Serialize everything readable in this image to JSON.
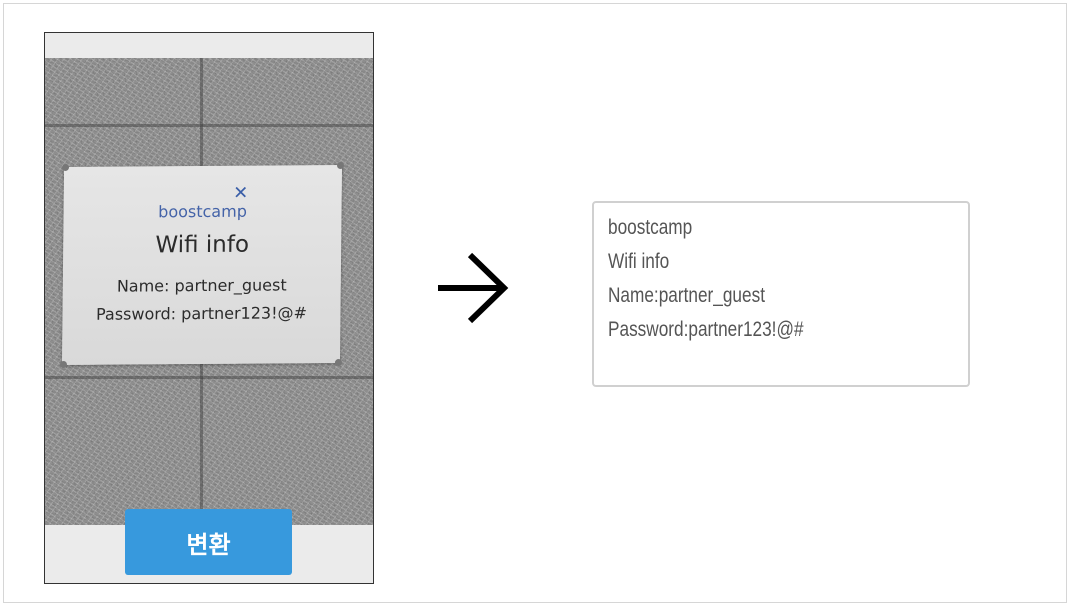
{
  "photo": {
    "sign": {
      "logo_mark": "✕",
      "logo_text": "boostcamp",
      "title": "Wifi info",
      "name_line": "Name: partner_guest",
      "password_line": "Password: partner123!@#"
    }
  },
  "convert_button": {
    "label": "변환"
  },
  "arrow_icon": "right-arrow-icon",
  "result": {
    "lines": [
      "boostcamp",
      "Wifi info",
      "Name:partner_guest",
      "Password:partner123!@#"
    ]
  },
  "colors": {
    "button_bg": "#3799dd",
    "button_text": "#ffffff",
    "result_text": "#555555",
    "sign_logo": "#4463a8"
  }
}
